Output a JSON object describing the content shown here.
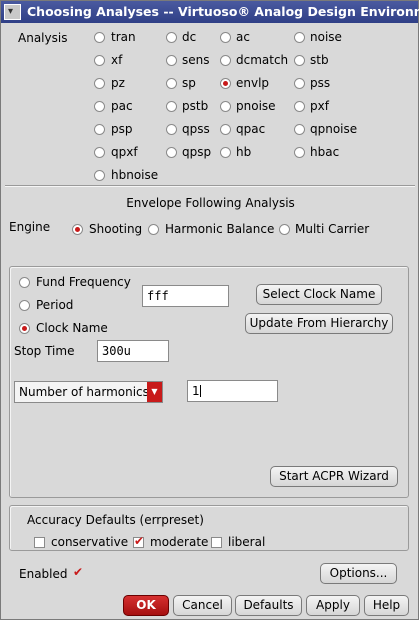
{
  "window": {
    "title": "Choosing Analyses -- Virtuoso® Analog Design Environn"
  },
  "analysis": {
    "label": "Analysis",
    "options": [
      "tran",
      "dc",
      "ac",
      "noise",
      "xf",
      "sens",
      "dcmatch",
      "stb",
      "pz",
      "sp",
      "envlp",
      "pss",
      "pac",
      "pstb",
      "pnoise",
      "pxf",
      "psp",
      "qpss",
      "qpac",
      "qpnoise",
      "qpxf",
      "qpsp",
      "hb",
      "hbac",
      "hbnoise"
    ],
    "selected": "envlp"
  },
  "envelope": {
    "heading": "Envelope Following Analysis",
    "engine_label": "Engine",
    "engines": [
      "Shooting",
      "Harmonic Balance",
      "Multi Carrier"
    ],
    "engine_selected": "Shooting"
  },
  "clock": {
    "modes": [
      "Fund Frequency",
      "Period",
      "Clock Name"
    ],
    "mode_selected": "Clock Name",
    "field_value": "fff",
    "select_clock_button": "Select Clock Name",
    "update_hierarchy_button": "Update From Hierarchy",
    "stop_time_label": "Stop Time",
    "stop_time_value": "300u",
    "harmonics_select": "Number of harmonics",
    "harmonics_value": "1",
    "acpr_button": "Start ACPR Wizard"
  },
  "accuracy": {
    "heading": "Accuracy Defaults (errpreset)",
    "options": [
      "conservative",
      "moderate",
      "liberal"
    ],
    "checked": [
      "moderate"
    ]
  },
  "enabled": {
    "label": "Enabled",
    "checked": true
  },
  "buttons": {
    "options": "Options...",
    "ok": "OK",
    "cancel": "Cancel",
    "defaults": "Defaults",
    "apply": "Apply",
    "help": "Help"
  },
  "colors": {
    "accent": "#c81a1a",
    "titlebar": "#2f3f86",
    "background": "#d9d9d9"
  }
}
